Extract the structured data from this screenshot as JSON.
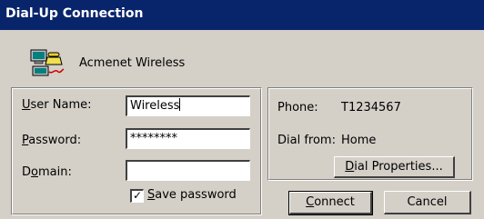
{
  "window": {
    "title": "Dial-Up Connection"
  },
  "connection": {
    "name": "Acmenet Wireless",
    "icon": "dialup-connection-icon"
  },
  "credentials": {
    "user_label_key": "U",
    "user_label_rest": "ser Name:",
    "user_value": "Wireless",
    "password_label_key": "P",
    "password_label_rest": "assword:",
    "password_value": "********",
    "domain_label_pre": "D",
    "domain_label_key": "o",
    "domain_label_rest": "main:",
    "domain_value": "",
    "save_password_checked": true,
    "save_label_key": "S",
    "save_label_rest": "ave password",
    "check_glyph": "✓"
  },
  "dial_info": {
    "phone_label": "Phone:",
    "phone_value": "T1234567",
    "dial_from_label": "Dial from:",
    "dial_from_value": "Home",
    "properties_button_key": "D",
    "properties_button_rest": "ial Properties..."
  },
  "buttons": {
    "connect_key": "C",
    "connect_rest": "onnect",
    "cancel": "Cancel"
  }
}
